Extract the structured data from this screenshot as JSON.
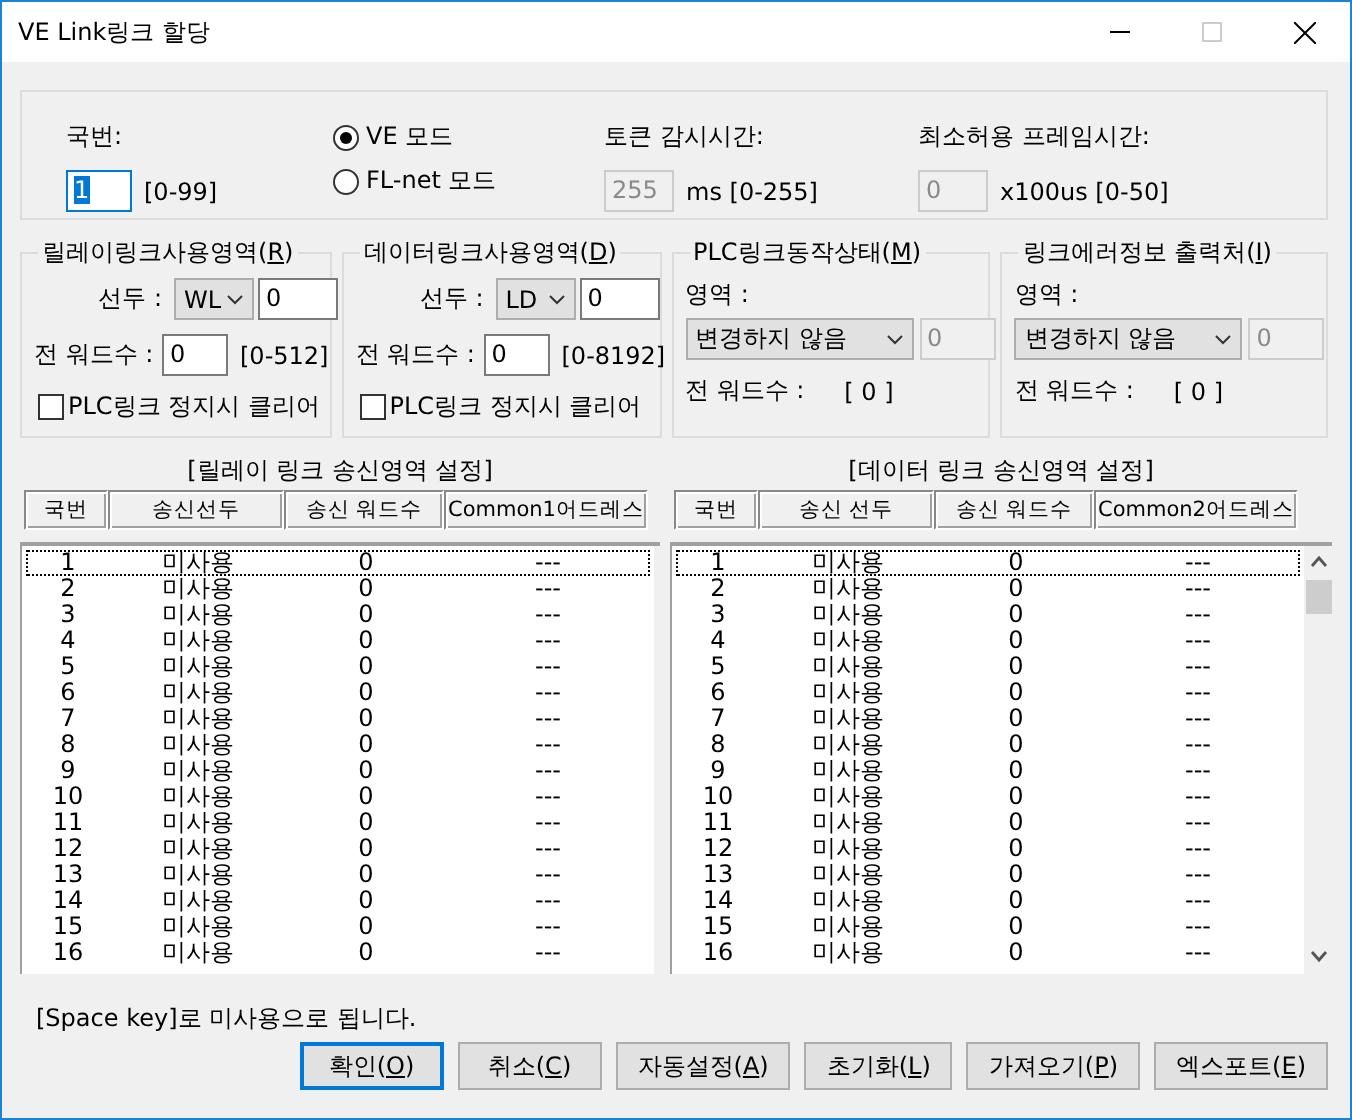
{
  "window": {
    "title": "VE Link링크 할당"
  },
  "station": {
    "label": "국번:",
    "value": "1",
    "range": "[0-99]"
  },
  "modes": [
    {
      "label": "VE 모드",
      "selected": true
    },
    {
      "label": "FL-net 모드",
      "selected": false
    }
  ],
  "token_time": {
    "label": "토큰 감시시간:",
    "value": "255",
    "unit": "ms [0-255]",
    "disabled": true
  },
  "min_frame_time": {
    "label": "최소허용 프레임시간:",
    "value": "0",
    "unit": "x100us [0-50]",
    "disabled": true
  },
  "relay_area": {
    "title": "릴레이링크사용영역(R)",
    "head_label": "선두 :",
    "device": "WL",
    "head_value": "0",
    "words_label": "전 워드수 :",
    "words_value": "0",
    "words_range": "[0-512]",
    "clear_label": "PLC링크 정지시 클리어",
    "checked": false
  },
  "data_area": {
    "title": "데이터링크사용영역(D)",
    "head_label": "선두 :",
    "device": "LD",
    "head_value": "0",
    "words_label": "전 워드수 :",
    "words_value": "0",
    "words_range": "[0-8192]",
    "clear_label": "PLC링크 정지시 클리어",
    "checked": false
  },
  "plc_status": {
    "title": "PLC링크동작상태(M)",
    "area_label": "영역 :",
    "area": "변경하지 않음",
    "area_value": "0",
    "area_value_disabled": true,
    "words_label": "전 워드수 :",
    "words_value": "[ 0 ]"
  },
  "error_output": {
    "title": "링크에러정보 출력처(I)",
    "area_label": "영역 :",
    "area": "변경하지 않음",
    "area_value": "0",
    "area_value_disabled": true,
    "words_label": "전 워드수 :",
    "words_value": "[ 0 ]"
  },
  "relay_table": {
    "title": "[릴레이 링크 송신영역 설정]",
    "columns": [
      "국번",
      "송신선두",
      "송신 워드수",
      "Common1어드레스"
    ],
    "rows": [
      {
        "cells": [
          "1",
          "미사용",
          "0",
          "---"
        ],
        "focused": true
      },
      {
        "cells": [
          "2",
          "미사용",
          "0",
          "---"
        ],
        "focused": false
      },
      {
        "cells": [
          "3",
          "미사용",
          "0",
          "---"
        ],
        "focused": false
      },
      {
        "cells": [
          "4",
          "미사용",
          "0",
          "---"
        ],
        "focused": false
      },
      {
        "cells": [
          "5",
          "미사용",
          "0",
          "---"
        ],
        "focused": false
      },
      {
        "cells": [
          "6",
          "미사용",
          "0",
          "---"
        ],
        "focused": false
      },
      {
        "cells": [
          "7",
          "미사용",
          "0",
          "---"
        ],
        "focused": false
      },
      {
        "cells": [
          "8",
          "미사용",
          "0",
          "---"
        ],
        "focused": false
      },
      {
        "cells": [
          "9",
          "미사용",
          "0",
          "---"
        ],
        "focused": false
      },
      {
        "cells": [
          "10",
          "미사용",
          "0",
          "---"
        ],
        "focused": false
      },
      {
        "cells": [
          "11",
          "미사용",
          "0",
          "---"
        ],
        "focused": false
      },
      {
        "cells": [
          "12",
          "미사용",
          "0",
          "---"
        ],
        "focused": false
      },
      {
        "cells": [
          "13",
          "미사용",
          "0",
          "---"
        ],
        "focused": false
      },
      {
        "cells": [
          "14",
          "미사용",
          "0",
          "---"
        ],
        "focused": false
      },
      {
        "cells": [
          "15",
          "미사용",
          "0",
          "---"
        ],
        "focused": false
      },
      {
        "cells": [
          "16",
          "미사용",
          "0",
          "---"
        ],
        "focused": false
      }
    ]
  },
  "data_table": {
    "title": "[데이터 링크 송신영역 설정]",
    "columns": [
      "국번",
      "송신 선두",
      "송신 워드수",
      "Common2어드레스"
    ],
    "rows": [
      {
        "cells": [
          "1",
          "미사용",
          "0",
          "---"
        ],
        "focused": true
      },
      {
        "cells": [
          "2",
          "미사용",
          "0",
          "---"
        ],
        "focused": false
      },
      {
        "cells": [
          "3",
          "미사용",
          "0",
          "---"
        ],
        "focused": false
      },
      {
        "cells": [
          "4",
          "미사용",
          "0",
          "---"
        ],
        "focused": false
      },
      {
        "cells": [
          "5",
          "미사용",
          "0",
          "---"
        ],
        "focused": false
      },
      {
        "cells": [
          "6",
          "미사용",
          "0",
          "---"
        ],
        "focused": false
      },
      {
        "cells": [
          "7",
          "미사용",
          "0",
          "---"
        ],
        "focused": false
      },
      {
        "cells": [
          "8",
          "미사용",
          "0",
          "---"
        ],
        "focused": false
      },
      {
        "cells": [
          "9",
          "미사용",
          "0",
          "---"
        ],
        "focused": false
      },
      {
        "cells": [
          "10",
          "미사용",
          "0",
          "---"
        ],
        "focused": false
      },
      {
        "cells": [
          "11",
          "미사용",
          "0",
          "---"
        ],
        "focused": false
      },
      {
        "cells": [
          "12",
          "미사용",
          "0",
          "---"
        ],
        "focused": false
      },
      {
        "cells": [
          "13",
          "미사용",
          "0",
          "---"
        ],
        "focused": false
      },
      {
        "cells": [
          "14",
          "미사용",
          "0",
          "---"
        ],
        "focused": false
      },
      {
        "cells": [
          "15",
          "미사용",
          "0",
          "---"
        ],
        "focused": false
      },
      {
        "cells": [
          "16",
          "미사용",
          "0",
          "---"
        ],
        "focused": false
      }
    ]
  },
  "hint": "[Space key]로 미사용으로 됩니다.",
  "buttons": [
    {
      "label": "확인(O)",
      "default": true
    },
    {
      "label": "취소(C)",
      "default": false
    },
    {
      "label": "자동설정(A)",
      "default": false
    },
    {
      "label": "초기화(L)",
      "default": false
    },
    {
      "label": "가져오기(P)",
      "default": false
    },
    {
      "label": "엑스포트(E)",
      "default": false
    }
  ]
}
